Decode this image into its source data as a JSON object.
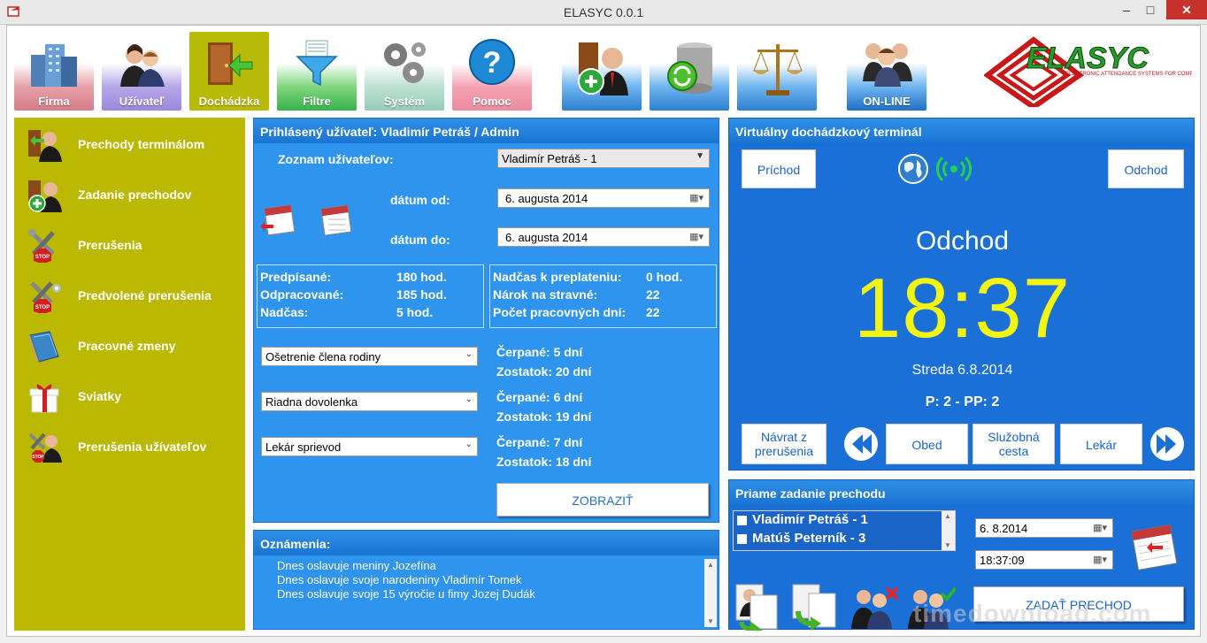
{
  "window": {
    "title": "ELASYC 0.0.1"
  },
  "toolbar": {
    "firma": "Firma",
    "uzivatel": "Užívateľ",
    "dochadzka": "Dochádzka",
    "filtre": "Filtre",
    "system": "Systém",
    "pomoc": "Pomoc",
    "online": "ON-LINE"
  },
  "logo": {
    "text": "ELASYC",
    "tagline": "ELECTRONIC ATTENDANCE SYSTEMS FOR COMPANIES"
  },
  "sidebar": {
    "items": [
      {
        "label": "Prechody terminálom",
        "icon": "user-door-icon"
      },
      {
        "label": "Zadanie prechodov",
        "icon": "user-add-icon"
      },
      {
        "label": "Prerušenia",
        "icon": "tools-stop-icon"
      },
      {
        "label": "Predvolené prerušenia",
        "icon": "tools-stop-gear-icon"
      },
      {
        "label": "Pracovné zmeny",
        "icon": "book-icon"
      },
      {
        "label": "Sviatky",
        "icon": "gift-icon"
      },
      {
        "label": "Prerušenia užívateľov",
        "icon": "user-stop-icon"
      }
    ]
  },
  "user_panel": {
    "header": "Prihlásený užívateľ: Vladimír Petráš / Admin",
    "user_list_label": "Zoznam užívateľov:",
    "user_selected": "Vladimír Petráš - 1",
    "date_from_label": "dátum od:",
    "date_from": "6.   augusta   2014",
    "date_to_label": "dátum do:",
    "date_to": "6.   augusta   2014",
    "stats_left": [
      {
        "label": "Predpísané:",
        "value": "180 hod."
      },
      {
        "label": "Odpracované:",
        "value": "185 hod."
      },
      {
        "label": "Nadčas:",
        "value": "5 hod."
      }
    ],
    "stats_right": [
      {
        "label": "Nadčas k preplateniu:",
        "value": "0 hod."
      },
      {
        "label": "Nárok na stravné:",
        "value": "22"
      },
      {
        "label": "Počet pracovných dní:",
        "value": "22"
      }
    ],
    "absences": [
      {
        "select": "Ošetrenie člena rodiny",
        "used": "Čerpané: 5 dní",
        "remaining": "Zostatok: 20 dní"
      },
      {
        "select": "Riadna dovolenka",
        "used": "Čerpané: 6 dní",
        "remaining": "Zostatok: 19 dní"
      },
      {
        "select": "Lekár sprievod",
        "used": "Čerpané: 7 dní",
        "remaining": "Zostatok: 18 dní"
      }
    ],
    "show_button": "ZOBRAZIŤ"
  },
  "announcements": {
    "header": "Oznámenia:",
    "lines": [
      "Dnes oslavuje meniny Jozefína",
      "Dnes oslavuje svoje narodeniny Vladimír Tomek",
      "Dnes oslavuje svoje 15 výročie u fimy Jozej Dudák"
    ]
  },
  "terminal": {
    "header": "Virtuálny dochádzkový terminál",
    "arrival": "Príchod",
    "departure": "Odchod",
    "status": "Odchod",
    "time": "18:37",
    "date": "Streda 6.8.2014",
    "counts": "P: 2 - PP: 2",
    "buttons": [
      "Návrat z prerušenia",
      "Obed",
      "Služobná cesta",
      "Lekár"
    ]
  },
  "direct_entry": {
    "header": "Priame zadanie prechodu",
    "users": [
      "Vladimír Petráš - 1",
      "Matúš Peterník - 3"
    ],
    "date": "6.  8.2014",
    "time": "18:37:09",
    "submit": "ZADAŤ PRECHOD"
  },
  "watermark": "timedownload.com",
  "colors": {
    "sidebar": "#bab800",
    "panel": "#2e94ee",
    "terminal": "#1b70d8",
    "time": "#f4f411"
  }
}
